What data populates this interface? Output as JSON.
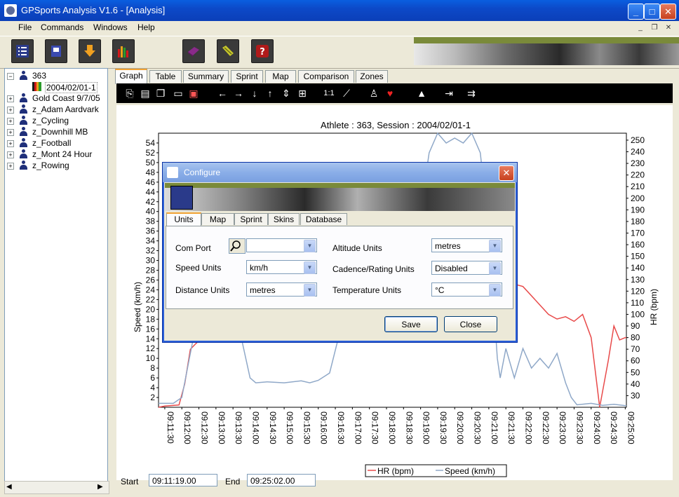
{
  "window": {
    "title": "GPSports Analysis V1.6 - [Analysis]"
  },
  "menu": {
    "file": "File",
    "commands": "Commands",
    "windows": "Windows",
    "help": "Help"
  },
  "tree": {
    "items": [
      {
        "label": "363",
        "expanded": true
      },
      {
        "label": "2004/02/01-1",
        "child": true
      },
      {
        "label": "Gold Coast 9/7/05"
      },
      {
        "label": "z_Adam Aardvark"
      },
      {
        "label": "z_Cycling"
      },
      {
        "label": "z_Downhill MB"
      },
      {
        "label": "z_Football"
      },
      {
        "label": "z_Mont 24 Hour"
      },
      {
        "label": "z_Rowing"
      }
    ]
  },
  "tabs": [
    "Graph",
    "Table",
    "Summary",
    "Sprint",
    "Map",
    "Comparison",
    "Zones"
  ],
  "footer": {
    "start_label": "Start",
    "start_value": "09:11:19.00",
    "end_label": "End",
    "end_value": "09:25:02.00"
  },
  "dialog": {
    "title": "Configure",
    "tabs": [
      "Units",
      "Map",
      "Sprint",
      "Skins",
      "Database"
    ],
    "com_port_label": "Com Port",
    "com_port_value": "",
    "speed_units_label": "Speed Units",
    "speed_units_value": "km/h",
    "distance_units_label": "Distance Units",
    "distance_units_value": "metres",
    "altitude_units_label": "Altitude Units",
    "altitude_units_value": "metres",
    "cadence_label": "Cadence/Rating Units",
    "cadence_value": "Disabled",
    "temperature_label": "Temperature Units",
    "temperature_value": "°C",
    "save_label": "Save",
    "close_label": "Close"
  },
  "colors": {
    "hr": "#e84a4a",
    "speed": "#8fa8c8",
    "titlebar": "#0a5fe0"
  },
  "chart_data": {
    "type": "line",
    "title": "Athlete : 363, Session : 2004/02/01-1",
    "xlabel": "",
    "ylabel": "Speed (km/h)",
    "y2label": "HR (bpm)",
    "x_ticks": [
      "09:11:30",
      "09:12:00",
      "09:12:30",
      "09:13:00",
      "09:13:30",
      "09:14:00",
      "09:14:30",
      "09:15:00",
      "09:15:30",
      "09:16:00",
      "09:16:30",
      "09:17:00",
      "09:17:30",
      "09:18:00",
      "09:18:30",
      "09:19:00",
      "09:19:30",
      "09:20:00",
      "09:20:30",
      "09:21:00",
      "09:21:30",
      "09:22:00",
      "09:22:30",
      "09:23:00",
      "09:23:30",
      "09:24:00",
      "09:24:30",
      "09:25:00"
    ],
    "y_ticks": [
      2,
      4,
      6,
      8,
      10,
      12,
      14,
      16,
      18,
      20,
      22,
      24,
      26,
      28,
      30,
      32,
      34,
      36,
      38,
      40,
      42,
      44,
      46,
      48,
      50,
      52,
      54
    ],
    "y2_ticks": [
      30,
      40,
      50,
      60,
      70,
      80,
      90,
      100,
      110,
      120,
      130,
      140,
      150,
      160,
      170,
      180,
      190,
      200,
      210,
      220,
      230,
      240,
      250
    ],
    "ylim": [
      0,
      56
    ],
    "y2lim": [
      20,
      256
    ],
    "xlim": [
      "09:11:19",
      "09:25:02"
    ],
    "grid": false,
    "legend": "bottom",
    "series": [
      {
        "name": "HR (bpm)",
        "axis": "right",
        "points": [
          [
            "09:11:19",
            20
          ],
          [
            "09:11:30",
            21
          ],
          [
            "09:11:55",
            22
          ],
          [
            "09:12:05",
            40
          ],
          [
            "09:12:15",
            70
          ],
          [
            "09:12:25",
            75
          ],
          [
            "09:12:40",
            82
          ],
          [
            "09:12:55",
            80
          ],
          [
            "09:13:10",
            82
          ],
          [
            "09:13:30",
            80
          ],
          [
            "09:13:45",
            82
          ],
          [
            "09:14:00",
            80
          ],
          [
            "09:14:15",
            76
          ],
          [
            "09:14:30",
            80
          ],
          [
            "09:14:45",
            78
          ],
          [
            "09:15:00",
            80
          ],
          [
            "09:15:15",
            76
          ],
          [
            "09:15:30",
            80
          ],
          [
            "09:15:45",
            78
          ],
          [
            "09:16:00",
            82
          ],
          [
            "09:16:30",
            85
          ],
          [
            "09:20:30",
            160
          ],
          [
            "09:21:00",
            150
          ],
          [
            "09:21:30",
            128
          ],
          [
            "09:22:00",
            124
          ],
          [
            "09:22:30",
            108
          ],
          [
            "09:22:45",
            100
          ],
          [
            "09:23:00",
            96
          ],
          [
            "09:23:15",
            98
          ],
          [
            "09:23:30",
            94
          ],
          [
            "09:23:45",
            100
          ],
          [
            "09:24:00",
            80
          ],
          [
            "09:24:10",
            40
          ],
          [
            "09:24:15",
            20
          ],
          [
            "09:24:30",
            60
          ],
          [
            "09:24:40",
            90
          ],
          [
            "09:24:50",
            78
          ],
          [
            "09:25:00",
            80
          ],
          [
            "09:25:02",
            80
          ]
        ]
      },
      {
        "name": "Speed (km/h)",
        "axis": "left",
        "points": [
          [
            "09:11:19",
            0.8
          ],
          [
            "09:11:45",
            0.8
          ],
          [
            "09:12:00",
            2
          ],
          [
            "09:12:10",
            8
          ],
          [
            "09:12:20",
            14
          ],
          [
            "09:12:30",
            15
          ],
          [
            "09:13:30",
            15
          ],
          [
            "09:13:45",
            14
          ],
          [
            "09:14:00",
            6
          ],
          [
            "09:14:10",
            5
          ],
          [
            "09:14:30",
            5.2
          ],
          [
            "09:15:00",
            5
          ],
          [
            "09:15:30",
            5.4
          ],
          [
            "09:15:45",
            5
          ],
          [
            "09:16:00",
            5.5
          ],
          [
            "09:16:20",
            7
          ],
          [
            "09:16:35",
            14
          ],
          [
            "09:16:50",
            16
          ],
          [
            "09:17:00",
            16
          ],
          [
            "09:19:00",
            40
          ],
          [
            "09:19:15",
            52
          ],
          [
            "09:19:30",
            56
          ],
          [
            "09:19:45",
            54
          ],
          [
            "09:20:00",
            55
          ],
          [
            "09:20:15",
            54
          ],
          [
            "09:20:30",
            56
          ],
          [
            "09:20:45",
            52
          ],
          [
            "09:21:00",
            36
          ],
          [
            "09:21:15",
            10
          ],
          [
            "09:21:20",
            6
          ],
          [
            "09:21:30",
            12
          ],
          [
            "09:21:45",
            6
          ],
          [
            "09:22:00",
            12
          ],
          [
            "09:22:15",
            8
          ],
          [
            "09:22:30",
            10
          ],
          [
            "09:22:45",
            8
          ],
          [
            "09:23:00",
            11
          ],
          [
            "09:23:15",
            5
          ],
          [
            "09:23:25",
            2
          ],
          [
            "09:23:35",
            0.5
          ],
          [
            "09:24:00",
            0.8
          ],
          [
            "09:24:20",
            0.4
          ],
          [
            "09:24:40",
            0.6
          ],
          [
            "09:25:02",
            0.3
          ]
        ]
      }
    ]
  }
}
